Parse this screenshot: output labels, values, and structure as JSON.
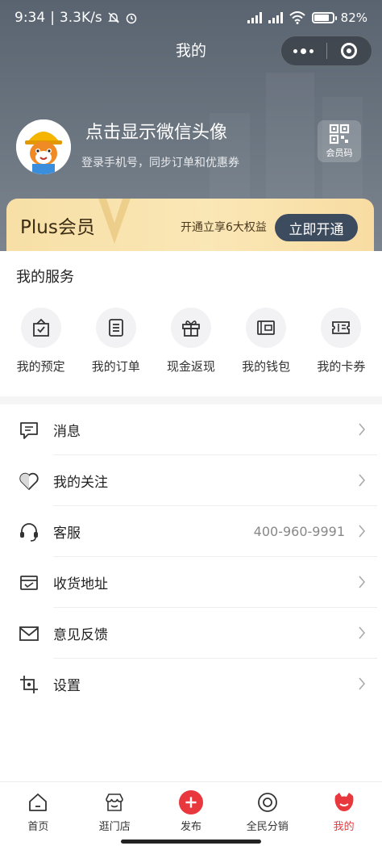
{
  "status_bar": {
    "time": "9:34",
    "speed": "3.3K/s",
    "battery": "82%",
    "battery_level": 0.82
  },
  "nav": {
    "title": "我的"
  },
  "profile": {
    "name": "点击显示微信头像",
    "subtitle": "登录手机号，同步订单和优惠券",
    "member_code_label": "会员码"
  },
  "plus": {
    "title": "Plus会员",
    "desc": "开通立享6大权益",
    "button": "立即开通"
  },
  "services": {
    "title": "我的服务",
    "items": [
      {
        "label": "我的预定",
        "icon": "calendar-check-icon"
      },
      {
        "label": "我的订单",
        "icon": "order-list-icon"
      },
      {
        "label": "现金返现",
        "icon": "gift-icon"
      },
      {
        "label": "我的钱包",
        "icon": "wallet-icon"
      },
      {
        "label": "我的卡券",
        "icon": "ticket-icon"
      }
    ]
  },
  "menu": [
    {
      "label": "消息",
      "icon": "message-icon",
      "value": ""
    },
    {
      "label": "我的关注",
      "icon": "heart-icon",
      "value": ""
    },
    {
      "label": "客服",
      "icon": "headset-icon",
      "value": "400-960-9991"
    },
    {
      "label": "收货地址",
      "icon": "address-card-icon",
      "value": ""
    },
    {
      "label": "意见反馈",
      "icon": "mail-icon",
      "value": ""
    },
    {
      "label": "设置",
      "icon": "settings-icon",
      "value": ""
    }
  ],
  "tabbar": [
    {
      "label": "首页",
      "icon": "home-icon",
      "active": false
    },
    {
      "label": "逛门店",
      "icon": "store-icon",
      "active": false
    },
    {
      "label": "发布",
      "icon": "plus-icon",
      "active": false
    },
    {
      "label": "全民分销",
      "icon": "target-icon",
      "active": false
    },
    {
      "label": "我的",
      "icon": "profile-icon",
      "active": true
    }
  ],
  "colors": {
    "header": "#5a6470",
    "accent": "#e8383d",
    "plus_button": "#3d4b5e",
    "plus_bg": "#f7dfa6"
  }
}
